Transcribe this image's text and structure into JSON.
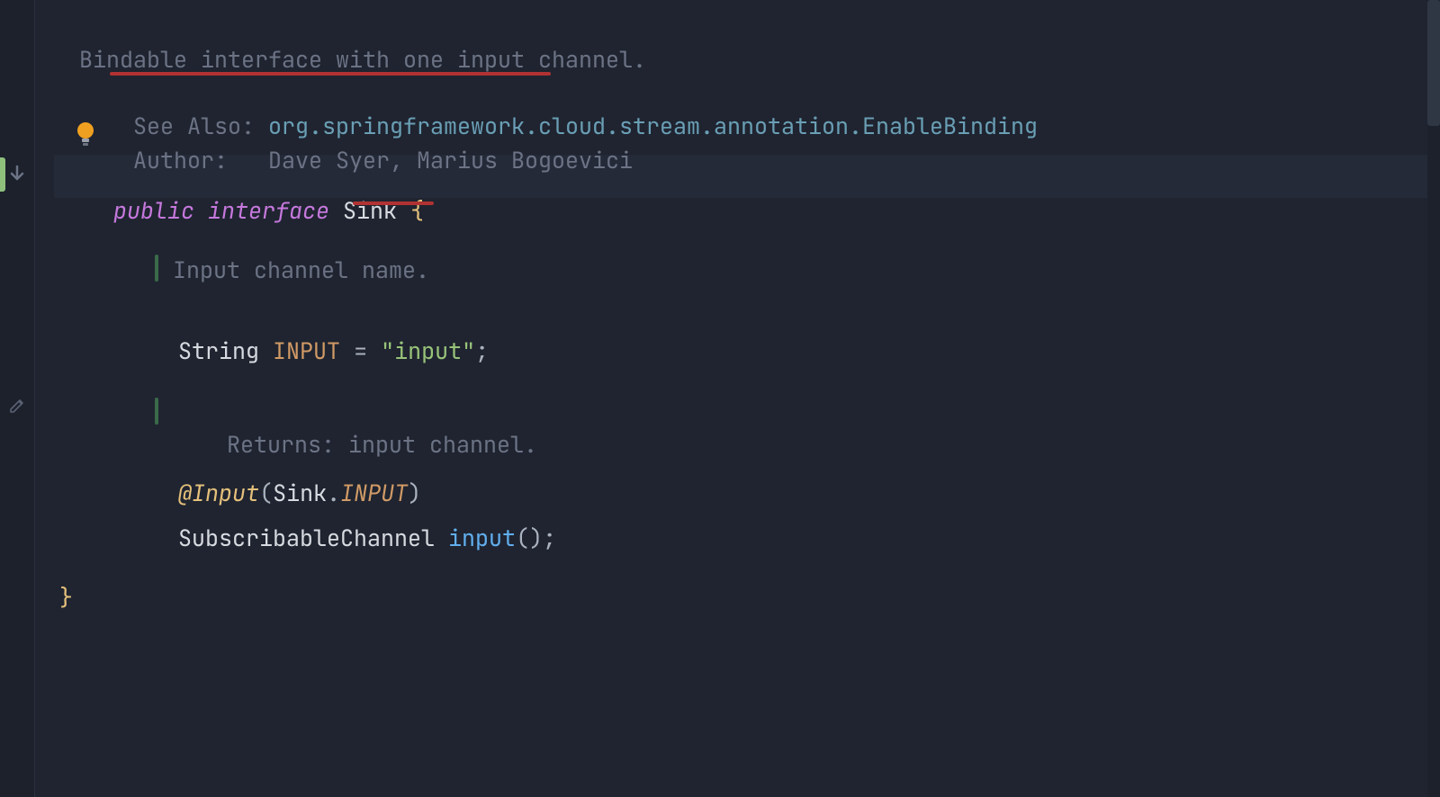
{
  "doc": {
    "description": "Bindable interface with one input channel.",
    "see_also_label": "See Also:",
    "see_also_link": "org.springframework.cloud.stream.annotation.EnableBinding",
    "author_label": "Author:",
    "authors": "Dave Syer, Marius Bogoevici",
    "field_doc": "Input channel name.",
    "method_doc_label": "Returns:",
    "method_doc_text": "input channel."
  },
  "code": {
    "modifiers": "public interface",
    "class_name": "Sink",
    "open_brace": " {",
    "field_type": "String",
    "field_name": "INPUT",
    "assign": " = ",
    "field_value": "\"input\"",
    "semi": ";",
    "anno_at": "@",
    "anno_name": "Input",
    "anno_open": "(",
    "anno_qual": "Sink",
    "anno_dot": ".",
    "anno_const": "INPUT",
    "anno_close": ")",
    "ret_type": "SubscribableChannel",
    "method_name": "input",
    "method_parens": "()",
    "close_brace": "}"
  },
  "icons": {
    "override_arrow": "override-down-icon",
    "edit_pencil": "edit-icon",
    "bulb": "intention-bulb-icon"
  },
  "colors": {
    "background": "#1f2430",
    "gutter": "#1c212c",
    "lineHighlight": "#242a38",
    "annotationRed": "#b03232"
  }
}
